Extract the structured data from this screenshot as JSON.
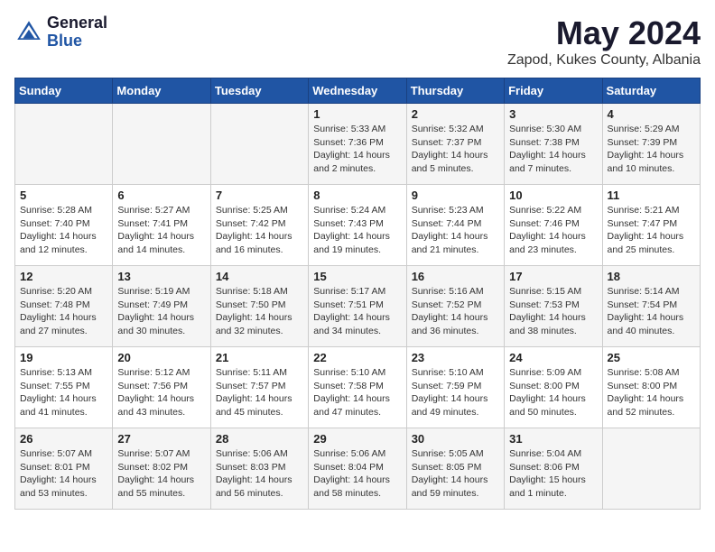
{
  "header": {
    "logo_general": "General",
    "logo_blue": "Blue",
    "title": "May 2024",
    "subtitle": "Zapod, Kukes County, Albania"
  },
  "days_of_week": [
    "Sunday",
    "Monday",
    "Tuesday",
    "Wednesday",
    "Thursday",
    "Friday",
    "Saturday"
  ],
  "weeks": [
    [
      {
        "day": "",
        "info": ""
      },
      {
        "day": "",
        "info": ""
      },
      {
        "day": "",
        "info": ""
      },
      {
        "day": "1",
        "info": "Sunrise: 5:33 AM\nSunset: 7:36 PM\nDaylight: 14 hours\nand 2 minutes."
      },
      {
        "day": "2",
        "info": "Sunrise: 5:32 AM\nSunset: 7:37 PM\nDaylight: 14 hours\nand 5 minutes."
      },
      {
        "day": "3",
        "info": "Sunrise: 5:30 AM\nSunset: 7:38 PM\nDaylight: 14 hours\nand 7 minutes."
      },
      {
        "day": "4",
        "info": "Sunrise: 5:29 AM\nSunset: 7:39 PM\nDaylight: 14 hours\nand 10 minutes."
      }
    ],
    [
      {
        "day": "5",
        "info": "Sunrise: 5:28 AM\nSunset: 7:40 PM\nDaylight: 14 hours\nand 12 minutes."
      },
      {
        "day": "6",
        "info": "Sunrise: 5:27 AM\nSunset: 7:41 PM\nDaylight: 14 hours\nand 14 minutes."
      },
      {
        "day": "7",
        "info": "Sunrise: 5:25 AM\nSunset: 7:42 PM\nDaylight: 14 hours\nand 16 minutes."
      },
      {
        "day": "8",
        "info": "Sunrise: 5:24 AM\nSunset: 7:43 PM\nDaylight: 14 hours\nand 19 minutes."
      },
      {
        "day": "9",
        "info": "Sunrise: 5:23 AM\nSunset: 7:44 PM\nDaylight: 14 hours\nand 21 minutes."
      },
      {
        "day": "10",
        "info": "Sunrise: 5:22 AM\nSunset: 7:46 PM\nDaylight: 14 hours\nand 23 minutes."
      },
      {
        "day": "11",
        "info": "Sunrise: 5:21 AM\nSunset: 7:47 PM\nDaylight: 14 hours\nand 25 minutes."
      }
    ],
    [
      {
        "day": "12",
        "info": "Sunrise: 5:20 AM\nSunset: 7:48 PM\nDaylight: 14 hours\nand 27 minutes."
      },
      {
        "day": "13",
        "info": "Sunrise: 5:19 AM\nSunset: 7:49 PM\nDaylight: 14 hours\nand 30 minutes."
      },
      {
        "day": "14",
        "info": "Sunrise: 5:18 AM\nSunset: 7:50 PM\nDaylight: 14 hours\nand 32 minutes."
      },
      {
        "day": "15",
        "info": "Sunrise: 5:17 AM\nSunset: 7:51 PM\nDaylight: 14 hours\nand 34 minutes."
      },
      {
        "day": "16",
        "info": "Sunrise: 5:16 AM\nSunset: 7:52 PM\nDaylight: 14 hours\nand 36 minutes."
      },
      {
        "day": "17",
        "info": "Sunrise: 5:15 AM\nSunset: 7:53 PM\nDaylight: 14 hours\nand 38 minutes."
      },
      {
        "day": "18",
        "info": "Sunrise: 5:14 AM\nSunset: 7:54 PM\nDaylight: 14 hours\nand 40 minutes."
      }
    ],
    [
      {
        "day": "19",
        "info": "Sunrise: 5:13 AM\nSunset: 7:55 PM\nDaylight: 14 hours\nand 41 minutes."
      },
      {
        "day": "20",
        "info": "Sunrise: 5:12 AM\nSunset: 7:56 PM\nDaylight: 14 hours\nand 43 minutes."
      },
      {
        "day": "21",
        "info": "Sunrise: 5:11 AM\nSunset: 7:57 PM\nDaylight: 14 hours\nand 45 minutes."
      },
      {
        "day": "22",
        "info": "Sunrise: 5:10 AM\nSunset: 7:58 PM\nDaylight: 14 hours\nand 47 minutes."
      },
      {
        "day": "23",
        "info": "Sunrise: 5:10 AM\nSunset: 7:59 PM\nDaylight: 14 hours\nand 49 minutes."
      },
      {
        "day": "24",
        "info": "Sunrise: 5:09 AM\nSunset: 8:00 PM\nDaylight: 14 hours\nand 50 minutes."
      },
      {
        "day": "25",
        "info": "Sunrise: 5:08 AM\nSunset: 8:00 PM\nDaylight: 14 hours\nand 52 minutes."
      }
    ],
    [
      {
        "day": "26",
        "info": "Sunrise: 5:07 AM\nSunset: 8:01 PM\nDaylight: 14 hours\nand 53 minutes."
      },
      {
        "day": "27",
        "info": "Sunrise: 5:07 AM\nSunset: 8:02 PM\nDaylight: 14 hours\nand 55 minutes."
      },
      {
        "day": "28",
        "info": "Sunrise: 5:06 AM\nSunset: 8:03 PM\nDaylight: 14 hours\nand 56 minutes."
      },
      {
        "day": "29",
        "info": "Sunrise: 5:06 AM\nSunset: 8:04 PM\nDaylight: 14 hours\nand 58 minutes."
      },
      {
        "day": "30",
        "info": "Sunrise: 5:05 AM\nSunset: 8:05 PM\nDaylight: 14 hours\nand 59 minutes."
      },
      {
        "day": "31",
        "info": "Sunrise: 5:04 AM\nSunset: 8:06 PM\nDaylight: 15 hours\nand 1 minute."
      },
      {
        "day": "",
        "info": ""
      }
    ]
  ]
}
